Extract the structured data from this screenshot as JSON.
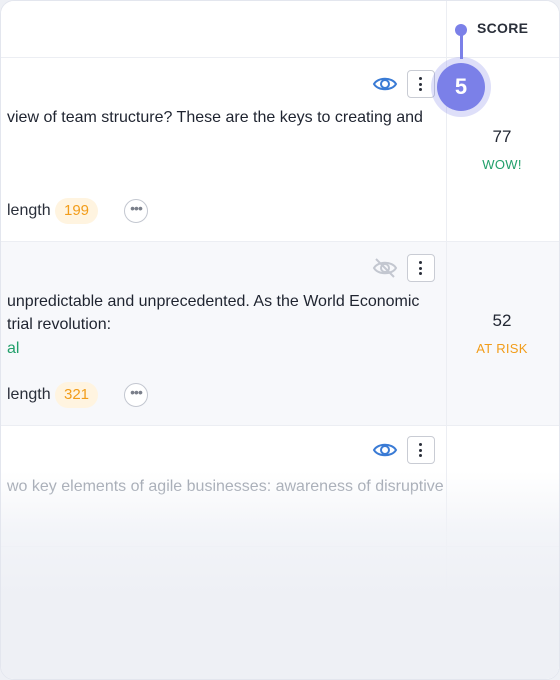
{
  "header": {
    "score_label": "SCORE"
  },
  "step_badge": {
    "number": "5"
  },
  "rows": [
    {
      "text_lines": [
        "view of team structure? These are the keys to creating and"
      ],
      "tag": "",
      "meta_label": "length",
      "length_value": "199",
      "visibility": "visible",
      "score": "77",
      "status": "WOW!",
      "status_color": "#22a06b"
    },
    {
      "text_lines": [
        "unpredictable and unprecedented. As the World Economic",
        "trial revolution:"
      ],
      "tag": "al",
      "meta_label": "length",
      "length_value": "321",
      "visibility": "hidden",
      "score": "52",
      "status": "AT RISK",
      "status_color": "#f29d1a"
    },
    {
      "text_lines": [
        "wo key elements of agile businesses: awareness of disruptive"
      ],
      "visibility": "visible"
    }
  ],
  "icons": {
    "eye": "eye-icon",
    "eye_off": "eye-off-icon",
    "kebab": "kebab-menu-icon",
    "more": "more-horizontal-icon"
  },
  "colors": {
    "accent": "#7b80e8",
    "eye_active": "#3a7bd5",
    "eye_inactive": "#c3c7d0",
    "badge_bg": "#fff4e0",
    "badge_text": "#f29d1a"
  }
}
